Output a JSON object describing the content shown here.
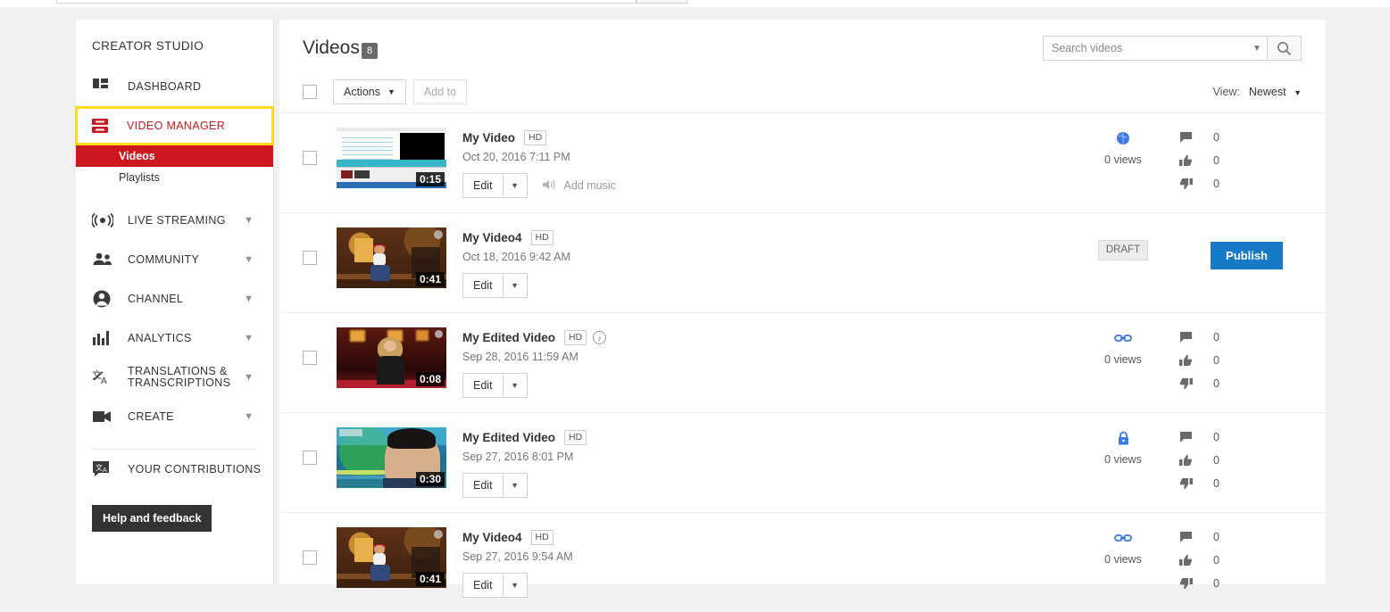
{
  "sidebar": {
    "title": "CREATOR STUDIO",
    "items": [
      {
        "label": "DASHBOARD",
        "icon": "dashboard-icon",
        "expandable": false,
        "active": false
      },
      {
        "label": "VIDEO MANAGER",
        "icon": "video-manager-icon",
        "expandable": false,
        "active": true
      },
      {
        "label": "LIVE STREAMING",
        "icon": "live-streaming-icon",
        "expandable": true,
        "active": false
      },
      {
        "label": "COMMUNITY",
        "icon": "community-icon",
        "expandable": true,
        "active": false
      },
      {
        "label": "CHANNEL",
        "icon": "channel-icon",
        "expandable": true,
        "active": false
      },
      {
        "label": "ANALYTICS",
        "icon": "analytics-icon",
        "expandable": true,
        "active": false
      },
      {
        "label": "TRANSLATIONS & TRANSCRIPTIONS",
        "icon": "translations-icon",
        "expandable": true,
        "active": false
      },
      {
        "label": "CREATE",
        "icon": "create-icon",
        "expandable": true,
        "active": false
      }
    ],
    "sub_items": [
      {
        "label": "Videos",
        "active": true
      },
      {
        "label": "Playlists",
        "active": false
      }
    ],
    "contributions_label": "YOUR CONTRIBUTIONS",
    "help_label": "Help and feedback",
    "active_outline_color": "#ffd91c",
    "active_sub_color": "#cc181e"
  },
  "header": {
    "page_title": "Videos",
    "video_count": "8",
    "search_placeholder": "Search videos",
    "search_value": ""
  },
  "toolbar": {
    "actions_label": "Actions",
    "add_to_label": "Add to",
    "view_label": "View:",
    "view_value": "Newest",
    "select_all_checked": false
  },
  "videos": [
    {
      "title": "My Video",
      "hd": "HD",
      "has_music_badge": false,
      "date": "Oct 20, 2016 7:11 PM",
      "duration": "0:15",
      "thumb_style": "art-editor",
      "edit_label": "Edit",
      "add_music_label": "Add music",
      "has_add_music": true,
      "privacy": "public",
      "privacy_icon": "globe-icon",
      "views": "0 views",
      "comments": "0",
      "likes": "0",
      "dislikes": "0",
      "is_draft": false
    },
    {
      "title": "My Video4",
      "hd": "HD",
      "has_music_badge": false,
      "date": "Oct 18, 2016 9:42 AM",
      "duration": "0:41",
      "thumb_style": "art-stage",
      "edit_label": "Edit",
      "add_music_label": "",
      "has_add_music": false,
      "privacy": "draft",
      "privacy_icon": "",
      "views": "",
      "comments": "",
      "likes": "",
      "dislikes": "",
      "is_draft": true,
      "draft_label": "DRAFT",
      "publish_label": "Publish"
    },
    {
      "title": "My Edited Video",
      "hd": "HD",
      "has_music_badge": true,
      "date": "Sep 28, 2016 11:59 AM",
      "duration": "0:08",
      "thumb_style": "art-red",
      "edit_label": "Edit",
      "add_music_label": "",
      "has_add_music": false,
      "privacy": "unlisted",
      "privacy_icon": "link-icon",
      "views": "0 views",
      "comments": "0",
      "likes": "0",
      "dislikes": "0",
      "is_draft": false
    },
    {
      "title": "My Edited Video",
      "hd": "HD",
      "has_music_badge": false,
      "date": "Sep 27, 2016 8:01 PM",
      "duration": "0:30",
      "thumb_style": "art-green",
      "edit_label": "Edit",
      "add_music_label": "",
      "has_add_music": false,
      "privacy": "private",
      "privacy_icon": "lock-icon",
      "views": "0 views",
      "comments": "0",
      "likes": "0",
      "dislikes": "0",
      "is_draft": false
    },
    {
      "title": "My Video4",
      "hd": "HD",
      "has_music_badge": false,
      "date": "Sep 27, 2016 9:54 AM",
      "duration": "0:41",
      "thumb_style": "art-stage",
      "edit_label": "Edit",
      "add_music_label": "",
      "has_add_music": false,
      "privacy": "unlisted",
      "privacy_icon": "link-icon",
      "views": "0 views",
      "comments": "0",
      "likes": "0",
      "dislikes": "0",
      "is_draft": false
    }
  ],
  "colors": {
    "youtube_red": "#cc181e",
    "highlight_yellow": "#ffd91c",
    "publish_blue": "#167ac6",
    "privacy_blue": "#3b78e7"
  }
}
